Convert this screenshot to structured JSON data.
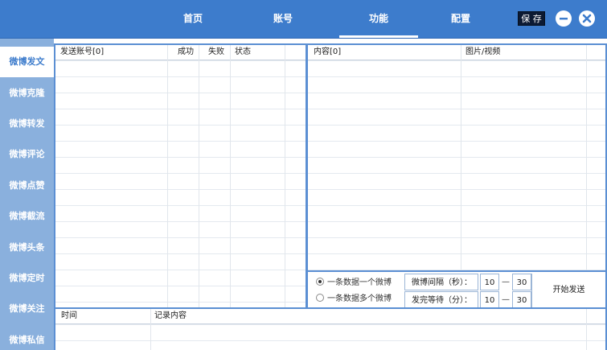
{
  "header": {
    "nav": [
      {
        "label": "首页"
      },
      {
        "label": "账号"
      },
      {
        "label": "功能"
      },
      {
        "label": "配置"
      }
    ],
    "save_label": "保 存",
    "bg_color": "#3d7ccc"
  },
  "sidebar": {
    "items": [
      {
        "label": "微博发文"
      },
      {
        "label": "微博克隆"
      },
      {
        "label": "微博转发"
      },
      {
        "label": "微博评论"
      },
      {
        "label": "微博点赞"
      },
      {
        "label": "微博截流"
      },
      {
        "label": "微博头条"
      },
      {
        "label": "微博定时"
      },
      {
        "label": "微博关注"
      },
      {
        "label": "微博私信"
      }
    ]
  },
  "accounts_table": {
    "headers": [
      "发送账号[0]",
      "成功",
      "失败",
      "状态"
    ]
  },
  "content_table": {
    "headers": [
      "内容[0]",
      "图片/视频"
    ]
  },
  "log_table": {
    "headers": [
      "时间",
      "记录内容"
    ]
  },
  "controls": {
    "radio_one": "一条数据一个微博",
    "radio_many": "一条数据多个微博",
    "interval_label": "微博间隔（秒）：",
    "wait_label": "发完等待（分）：",
    "interval_min": "10",
    "interval_max": "30",
    "wait_min": "10",
    "wait_max": "30",
    "dash": "—",
    "start_label": "开始发送"
  }
}
